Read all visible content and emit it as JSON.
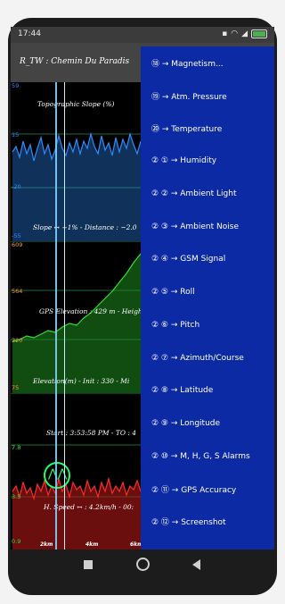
{
  "status": {
    "time": "17:44"
  },
  "app": {
    "title": "R_TW : Chemin Du Paradis"
  },
  "charts": {
    "slope": {
      "title": "Topographic Slope (%)",
      "subtitle": "Slope ↔ +1% - Distance : ~2.0",
      "ylabels": [
        "59",
        "15",
        "-20",
        "-55"
      ],
      "color": "#2d8cff"
    },
    "elevation": {
      "title": "GPS Elevation : 429 m - Heigh",
      "subtitle": "Elevation(m) - Init : 330 - Mi",
      "ylabels": [
        "609",
        "564",
        "320",
        "75"
      ],
      "color": "#33dd33"
    },
    "speed": {
      "title": "Start : 3:53:58 PM - TO : 4",
      "subtitle": "H. Speed ↔ : 4.2km/h - 00:",
      "ylabels": [
        "7.8",
        "3.5",
        "0.9"
      ],
      "xlabels": [
        "2km",
        "4km",
        "6km"
      ],
      "color": "#ff2a2a"
    }
  },
  "menu": {
    "items": [
      "⑱ → Magnetism...",
      "⑲ → Atm. Pressure",
      "⑳ → Temperature",
      "② ① → Humidity",
      "② ② → Ambient Light",
      "② ③ → Ambient Noise",
      "② ④ → GSM Signal",
      "② ⑤ → Roll",
      "② ⑥ → Pitch",
      "② ⑦ → Azimuth/Course",
      "② ⑧ → Latitude",
      "② ⑨ → Longitude",
      "② ⑩ → M, H, G, S Alarms",
      "② ⑪ → GPS Accuracy",
      "② ⑫ → Screenshot"
    ]
  }
}
